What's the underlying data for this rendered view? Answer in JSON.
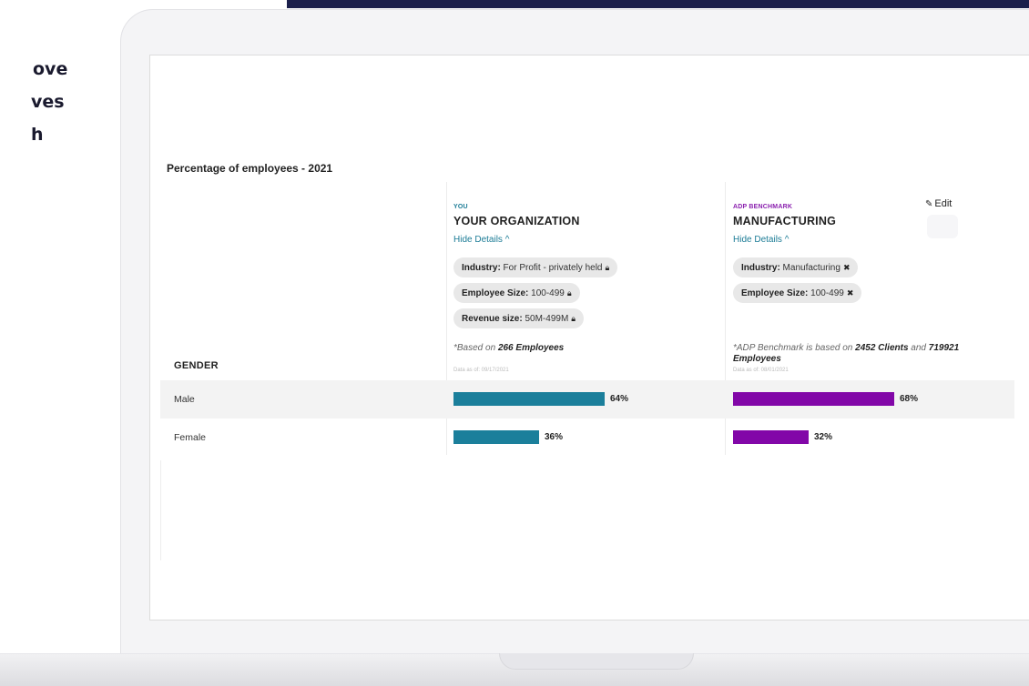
{
  "promo": {
    "lines": [
      "ove",
      "ves",
      "h"
    ]
  },
  "header": {
    "title": "Percentage of employees - 2021",
    "edit_label": "Edit"
  },
  "columns": {
    "you": {
      "tag": "YOU",
      "title": "YOUR ORGANIZATION",
      "toggle": "Hide Details ^",
      "chips": [
        {
          "key": "Industry:",
          "value": " For Profit - privately held",
          "icon": "lock-icon"
        },
        {
          "key": "Employee Size:",
          "value": " 100-499",
          "icon": "lock-icon"
        },
        {
          "key": "Revenue size:",
          "value": " 50M-499M",
          "icon": "lock-icon"
        }
      ],
      "based_prefix": "*Based on ",
      "based_count": "266 Employees",
      "as_of": "Data as of: 09/17/2021"
    },
    "adp": {
      "tag": "ADP BENCHMARK",
      "title": "MANUFACTURING",
      "toggle": "Hide Details ^",
      "chips": [
        {
          "key": "Industry:",
          "value": " Manufacturing",
          "icon": "close-icon"
        },
        {
          "key": "Employee Size:",
          "value": " 100-499",
          "icon": "close-icon"
        }
      ],
      "based_prefix": "*ADP Benchmark is based on ",
      "based_clients": "2452 Clients",
      "based_mid": " and ",
      "based_employees_num": "719921",
      "based_employees_word": "Employees",
      "as_of": "Data as of: 08/01/2021"
    }
  },
  "section": {
    "label": "GENDER"
  },
  "rows": [
    {
      "label": "Male",
      "you_pct": 64,
      "you_label": "64%",
      "adp_pct": 68,
      "adp_label": "68%"
    },
    {
      "label": "Female",
      "you_pct": 36,
      "you_label": "36%",
      "adp_pct": 32,
      "adp_label": "32%"
    }
  ],
  "colors": {
    "you": "#1b7f9b",
    "adp": "#8207a8",
    "navy": "#1b1f4b"
  }
}
